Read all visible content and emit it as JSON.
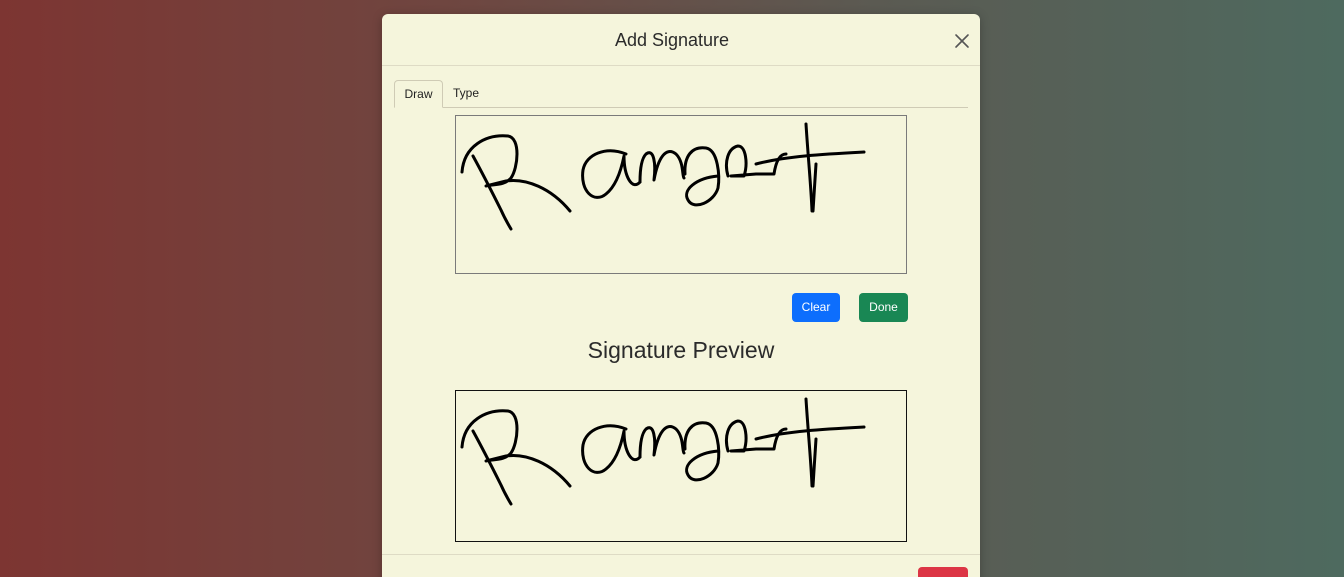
{
  "modal": {
    "title": "Add Signature",
    "close_icon": "close-icon"
  },
  "tabs": [
    {
      "label": "Draw",
      "active": true
    },
    {
      "label": "Type",
      "active": false
    }
  ],
  "actions": {
    "clear_label": "Clear",
    "done_label": "Done"
  },
  "preview": {
    "title": "Signature Preview"
  },
  "colors": {
    "modal_bg": "#f5f5dc",
    "clear_button": "#0d6efd",
    "done_button": "#198754",
    "footer_button": "#dc3545"
  }
}
